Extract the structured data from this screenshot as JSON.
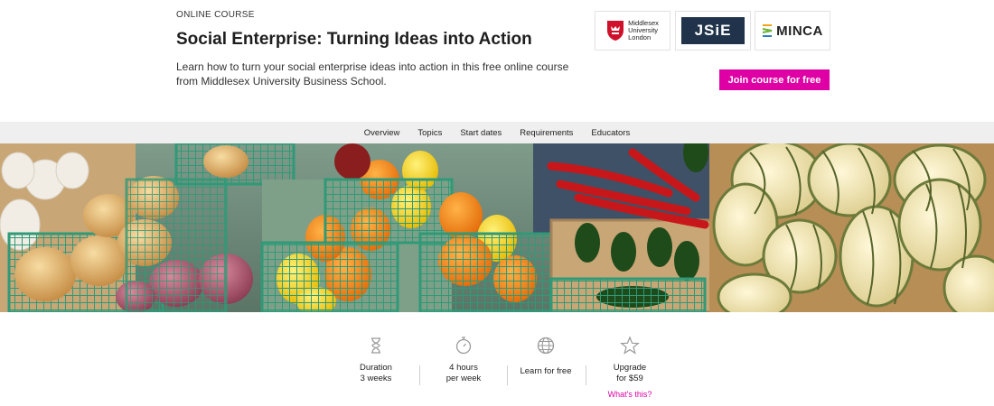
{
  "header": {
    "eyebrow": "ONLINE COURSE",
    "title": "Social Enterprise: Turning Ideas into Action",
    "description": "Learn how to turn your social enterprise ideas into action in this free online course from Middlesex University Business School.",
    "join_label": "Join course for free"
  },
  "logos": {
    "mdx": {
      "line1": "Middlesex",
      "line2": "University",
      "line3": "London"
    },
    "jsie": "JSiE",
    "minca": "MINCA"
  },
  "nav": [
    "Overview",
    "Topics",
    "Start dates",
    "Requirements",
    "Educators"
  ],
  "stats": {
    "duration": {
      "line1": "Duration",
      "line2": "3 weeks",
      "icon": "hourglass-icon"
    },
    "hours": {
      "line1": "4 hours",
      "line2": "per week",
      "icon": "stopwatch-icon"
    },
    "free": {
      "line1": "Learn for free",
      "icon": "globe-icon"
    },
    "upgrade": {
      "line1": "Upgrade",
      "line2": "for $59",
      "link": "What's this?",
      "icon": "star-icon"
    }
  },
  "colors": {
    "accent": "#de00a5",
    "nav_bg": "#efefef",
    "jsie_bg": "#20334a"
  }
}
